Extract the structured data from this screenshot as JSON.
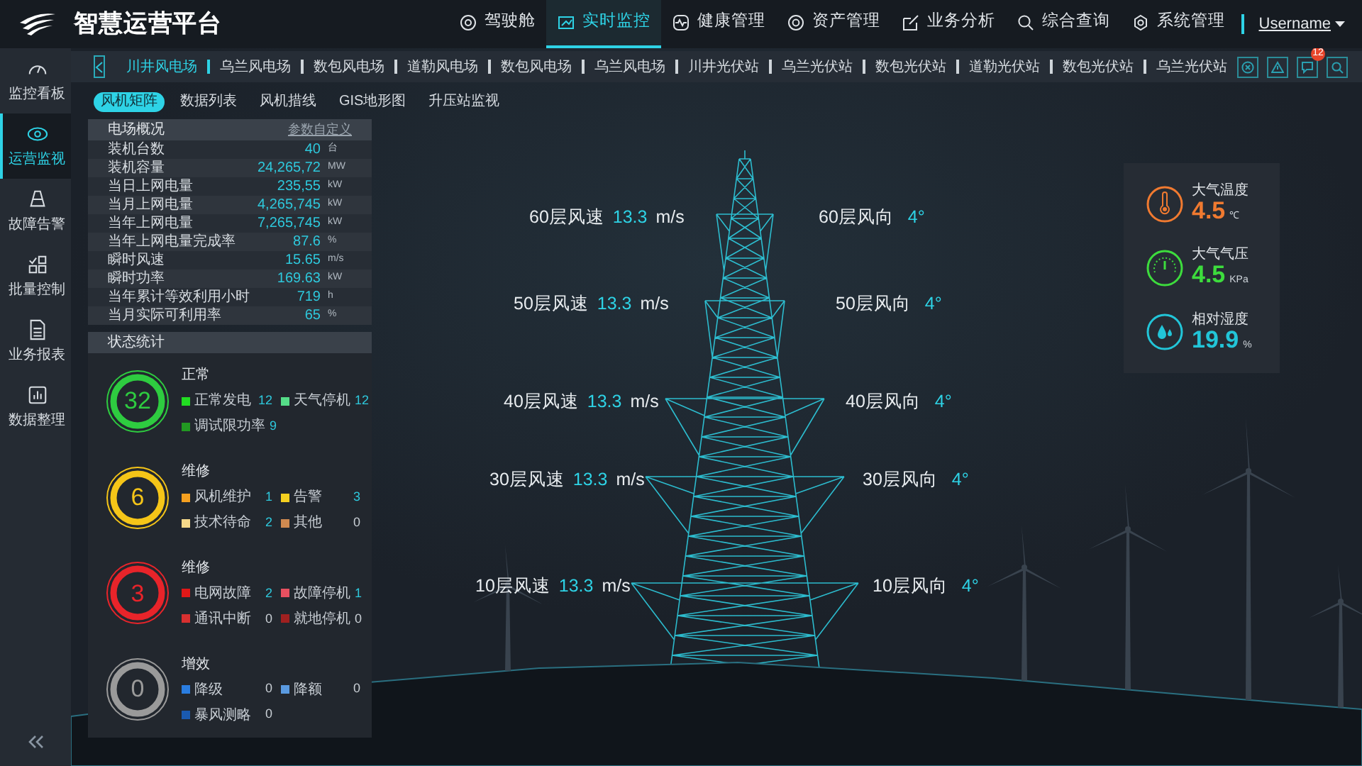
{
  "header": {
    "title": "智慧运营平台",
    "nav": [
      {
        "label": "驾驶舱",
        "selected": false
      },
      {
        "label": "实时监控",
        "selected": true
      },
      {
        "label": "健康管理",
        "selected": false
      },
      {
        "label": "资产管理",
        "selected": false
      },
      {
        "label": "业务分析",
        "selected": false
      },
      {
        "label": "综合查询",
        "selected": false
      },
      {
        "label": "系统管理",
        "selected": false
      }
    ],
    "username": "Username"
  },
  "sidebar": {
    "items": [
      {
        "label": "监控看板",
        "selected": false
      },
      {
        "label": "运营监视",
        "selected": true
      },
      {
        "label": "故障告警",
        "selected": false
      },
      {
        "label": "批量控制",
        "selected": false
      },
      {
        "label": "业务报表",
        "selected": false
      },
      {
        "label": "数据整理",
        "selected": false
      }
    ]
  },
  "stations": [
    {
      "label": "川井风电场",
      "selected": true
    },
    {
      "label": "乌兰风电场",
      "selected": false
    },
    {
      "label": "数包风电场",
      "selected": false
    },
    {
      "label": "道勒风电场",
      "selected": false
    },
    {
      "label": "数包风电场",
      "selected": false
    },
    {
      "label": "乌兰风电场",
      "selected": false
    },
    {
      "label": "川井光伏站",
      "selected": false
    },
    {
      "label": "乌兰光伏站",
      "selected": false
    },
    {
      "label": "数包光伏站",
      "selected": false
    },
    {
      "label": "道勒光伏站",
      "selected": false
    },
    {
      "label": "数包光伏站",
      "selected": false
    },
    {
      "label": "乌兰光伏站",
      "selected": false
    }
  ],
  "toolbar": {
    "message_badge": "12"
  },
  "view_tabs": [
    {
      "label": "风机矩阵",
      "selected": true
    },
    {
      "label": "数据列表",
      "selected": false
    },
    {
      "label": "风机措线",
      "selected": false
    },
    {
      "label": "GIS地形图",
      "selected": false
    },
    {
      "label": "升压站监视",
      "selected": false
    }
  ],
  "overview": {
    "title": "电场概况",
    "link": "参数自定义",
    "rows": [
      {
        "label": "装机台数",
        "value": "40",
        "unit": "台"
      },
      {
        "label": "装机容量",
        "value": "24,265,72",
        "unit": "MW"
      },
      {
        "label": "当日上网电量",
        "value": "235,55",
        "unit": "kW"
      },
      {
        "label": "当月上网电量",
        "value": "4,265,745",
        "unit": "kW"
      },
      {
        "label": "当年上网电量",
        "value": "7,265,745",
        "unit": "kW"
      },
      {
        "label": "当年上网电量完成率",
        "value": "87.6",
        "unit": "%"
      },
      {
        "label": "瞬时风速",
        "value": "15.65",
        "unit": "m/s"
      },
      {
        "label": "瞬时功率",
        "value": "169.63",
        "unit": "kW"
      },
      {
        "label": "当年累计等效利用小时",
        "value": "719",
        "unit": "h"
      },
      {
        "label": "当月实际可利用率",
        "value": "65",
        "unit": "%"
      }
    ]
  },
  "status": {
    "title": "状态统计",
    "groups": [
      {
        "count": "32",
        "title": "正常",
        "color": "#2ecc40",
        "items": [
          {
            "label": "正常发电",
            "value": "12",
            "color": "#22dd22"
          },
          {
            "label": "天气停机",
            "value": "12",
            "color": "#55dd88"
          },
          {
            "label": "调试限功率",
            "value": "9",
            "color": "#229922"
          }
        ]
      },
      {
        "count": "6",
        "title": "维修",
        "color": "#f5c518",
        "items": [
          {
            "label": "风机维护",
            "value": "1",
            "color": "#f5a020"
          },
          {
            "label": "告警",
            "value": "3",
            "color": "#f5d020"
          },
          {
            "label": "技术待命",
            "value": "2",
            "color": "#f5d98a"
          },
          {
            "label": "其他",
            "value": "0",
            "color": "#d08a50"
          }
        ]
      },
      {
        "count": "3",
        "title": "维修",
        "color": "#e8242a",
        "items": [
          {
            "label": "电网故障",
            "value": "2",
            "color": "#e01818"
          },
          {
            "label": "故障停机",
            "value": "1",
            "color": "#e85060"
          },
          {
            "label": "通讯中断",
            "value": "0",
            "color": "#d83030"
          },
          {
            "label": "就地停机",
            "value": "0",
            "color": "#a02020"
          }
        ]
      },
      {
        "count": "0",
        "title": "增效",
        "color": "#9a9a9a",
        "items": [
          {
            "label": "降级",
            "value": "0",
            "color": "#2a7de0"
          },
          {
            "label": "降额",
            "value": "0",
            "color": "#5a9ae0"
          },
          {
            "label": "暴风测略",
            "value": "0",
            "color": "#1a5ab0"
          }
        ]
      }
    ]
  },
  "tower_readings": [
    {
      "speed_label": "60层风速",
      "speed_value": "13.3",
      "speed_unit": "m/s",
      "direction_label": "60层风向",
      "direction_value": "4°"
    },
    {
      "speed_label": "50层风速",
      "speed_value": "13.3",
      "speed_unit": "m/s",
      "direction_label": "50层风向",
      "direction_value": "4°"
    },
    {
      "speed_label": "40层风速",
      "speed_value": "13.3",
      "speed_unit": "m/s",
      "direction_label": "40层风向",
      "direction_value": "4°"
    },
    {
      "speed_label": "30层风速",
      "speed_value": "13.3",
      "speed_unit": "m/s",
      "direction_label": "30层风向",
      "direction_value": "4°"
    },
    {
      "speed_label": "10层风速",
      "speed_value": "13.3",
      "speed_unit": "m/s",
      "direction_label": "10层风向",
      "direction_value": "4°"
    }
  ],
  "weather": [
    {
      "kind": "temperature",
      "label": "大气温度",
      "value": "4.5",
      "unit": "℃",
      "color": "#f07a30"
    },
    {
      "kind": "pressure",
      "label": "大气气压",
      "value": "4.5",
      "unit": "KPa",
      "color": "#3ddc3d"
    },
    {
      "kind": "humidity",
      "label": "相对湿度",
      "value": "19.9",
      "unit": "%",
      "color": "#22c5d8"
    }
  ]
}
